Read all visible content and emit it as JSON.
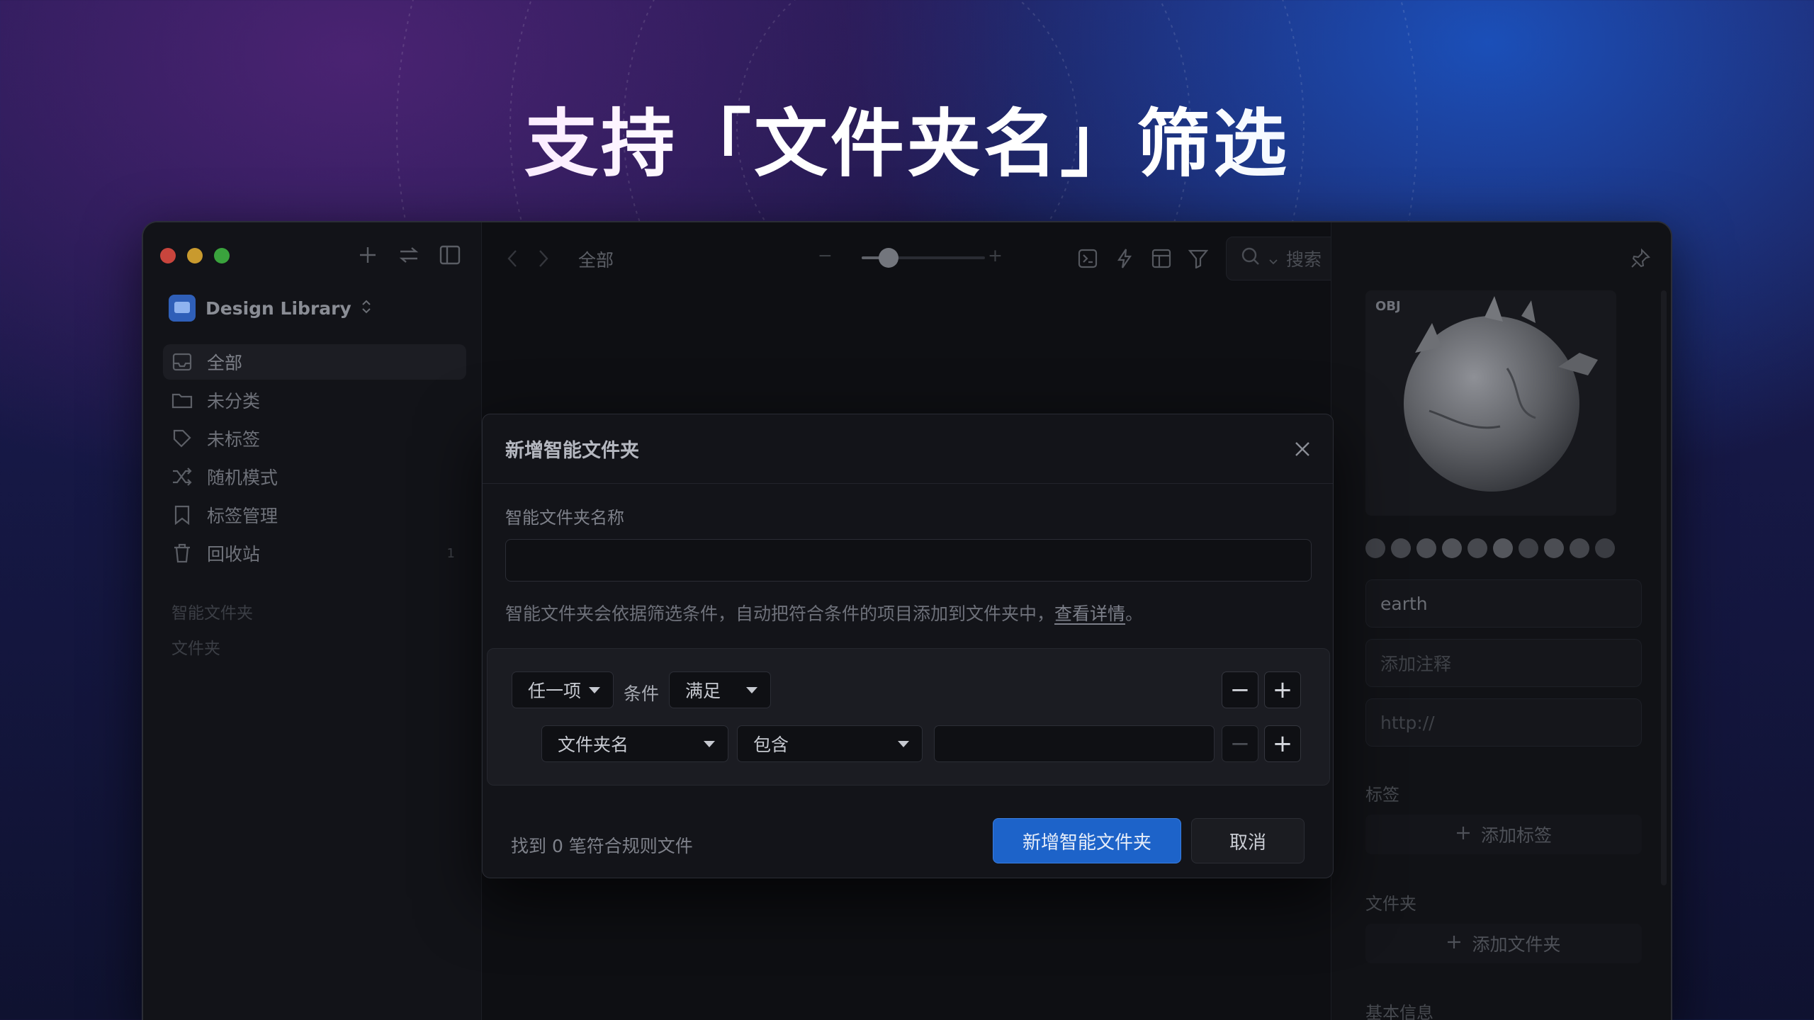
{
  "headline": "支持「文件夹名」筛选",
  "sidebar": {
    "library_name": "Design Library",
    "library_switch": "⌃",
    "items": [
      {
        "label": "全部",
        "icon": "inbox-icon"
      },
      {
        "label": "未分类",
        "icon": "folder-icon"
      },
      {
        "label": "未标签",
        "icon": "tag-icon"
      },
      {
        "label": "随机模式",
        "icon": "shuffle-icon"
      },
      {
        "label": "标签管理",
        "icon": "bookmark-icon"
      },
      {
        "label": "回收站",
        "icon": "trash-icon",
        "count": "1"
      }
    ],
    "sections": {
      "smart_folders": "智能文件夹",
      "folders": "文件夹"
    }
  },
  "toolbar": {
    "breadcrumb": "全部",
    "zoom_minus": "−",
    "zoom_plus": "+",
    "search_placeholder": "搜索"
  },
  "inspector": {
    "badge": "OBJ",
    "name_value": "earth",
    "note_placeholder": "添加注释",
    "url_placeholder": "http://",
    "tags_label": "标签",
    "add_tag": "添加标签",
    "folders_label": "文件夹",
    "add_folder": "添加文件夹",
    "basic_info_label": "基本信息",
    "color_swatches": [
      "#3f4147",
      "#45474d",
      "#4a4c52",
      "#505258",
      "#46484e",
      "#54565c",
      "#3d3f45",
      "#4b4d53",
      "#44464c",
      "#3a3c42"
    ]
  },
  "dialog": {
    "title": "新增智能文件夹",
    "name_label": "智能文件夹名称",
    "name_value": "",
    "hint_text": "智能文件夹会依据筛选条件，自动把符合条件的项目添加到文件夹中，",
    "hint_link": "查看详情",
    "hint_end": "。",
    "match_mode": "任一项",
    "condition_word": "条件",
    "satisfy": "满足",
    "rule_field": "文件夹名",
    "rule_operator": "包含",
    "rule_value": "",
    "minus": "−",
    "plus": "+",
    "found_text": "找到 0 笔符合规则文件",
    "confirm_button": "新增智能文件夹",
    "cancel_button": "取消"
  },
  "colors": {
    "accent": "#1d63c9",
    "window_bg": "#0e0f13"
  }
}
